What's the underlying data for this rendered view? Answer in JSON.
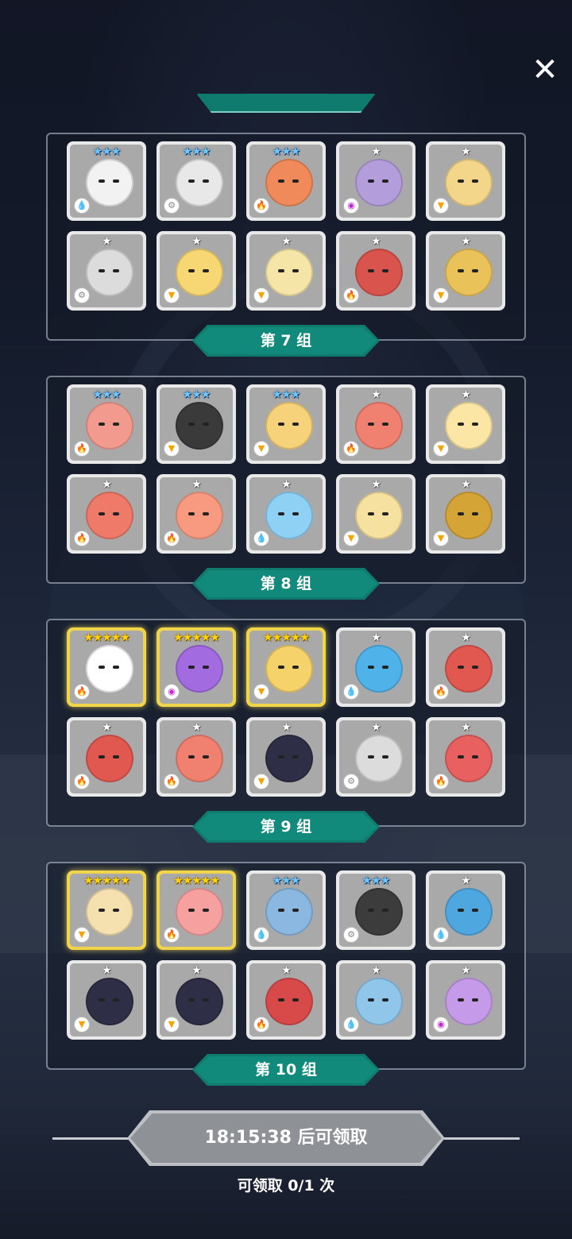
{
  "close_label": "✕",
  "colors": {
    "ribbon": "#0f7a6e",
    "timer_button": "#8e9196",
    "star_blue": "#6ec6ff",
    "star_gold": "#ffd400"
  },
  "groups": [
    {
      "label": "第 7 组",
      "heroes": [
        {
          "stars": "★★★",
          "rank": "blue",
          "element": "water",
          "elem_glyph": "💧",
          "color": "#f2f2f2"
        },
        {
          "stars": "★★★",
          "rank": "blue",
          "element": "neutral",
          "elem_glyph": "⚙",
          "color": "#e8e8e8"
        },
        {
          "stars": "★★★",
          "rank": "blue",
          "element": "fire",
          "elem_glyph": "🔥",
          "color": "#f08a5a"
        },
        {
          "stars": "★",
          "rank": "white",
          "element": "dark",
          "elem_glyph": "◉",
          "color": "#b39ddb"
        },
        {
          "stars": "★",
          "rank": "white",
          "element": "light",
          "elem_glyph": "▼",
          "color": "#f3d68a"
        },
        {
          "stars": "★",
          "rank": "white",
          "element": "neutral",
          "elem_glyph": "⚙",
          "color": "#dcdcdc"
        },
        {
          "stars": "★",
          "rank": "white",
          "element": "light",
          "elem_glyph": "▼",
          "color": "#f7d774"
        },
        {
          "stars": "★",
          "rank": "white",
          "element": "light",
          "elem_glyph": "▼",
          "color": "#f5e6a8"
        },
        {
          "stars": "★",
          "rank": "white",
          "element": "fire",
          "elem_glyph": "🔥",
          "color": "#d9544d"
        },
        {
          "stars": "★",
          "rank": "white",
          "element": "light",
          "elem_glyph": "▼",
          "color": "#e9c25a"
        }
      ]
    },
    {
      "label": "第 8 组",
      "heroes": [
        {
          "stars": "★★★",
          "rank": "blue",
          "element": "fire",
          "elem_glyph": "🔥",
          "color": "#f29a8e"
        },
        {
          "stars": "★★★",
          "rank": "blue",
          "element": "light",
          "elem_glyph": "▼",
          "color": "#3a3a3a"
        },
        {
          "stars": "★★★",
          "rank": "blue",
          "element": "light",
          "elem_glyph": "▼",
          "color": "#f6d27a"
        },
        {
          "stars": "★",
          "rank": "white",
          "element": "fire",
          "elem_glyph": "🔥",
          "color": "#f08070"
        },
        {
          "stars": "★",
          "rank": "white",
          "element": "light",
          "elem_glyph": "▼",
          "color": "#fbe6a6"
        },
        {
          "stars": "★",
          "rank": "white",
          "element": "fire",
          "elem_glyph": "🔥",
          "color": "#ef7a6a"
        },
        {
          "stars": "★",
          "rank": "white",
          "element": "fire",
          "elem_glyph": "🔥",
          "color": "#f79a80"
        },
        {
          "stars": "★",
          "rank": "white",
          "element": "water",
          "elem_glyph": "💧",
          "color": "#8fd0f5"
        },
        {
          "stars": "★",
          "rank": "white",
          "element": "light",
          "elem_glyph": "▼",
          "color": "#f7e1a0"
        },
        {
          "stars": "★",
          "rank": "white",
          "element": "light",
          "elem_glyph": "▼",
          "color": "#d4a437"
        }
      ]
    },
    {
      "label": "第 9 组",
      "heroes": [
        {
          "stars": "★★★★★",
          "rank": "gold",
          "element": "fire",
          "elem_glyph": "🔥",
          "color": "#ffffff"
        },
        {
          "stars": "★★★★★",
          "rank": "gold",
          "element": "dark",
          "elem_glyph": "◉",
          "color": "#a36be0"
        },
        {
          "stars": "★★★★★",
          "rank": "gold",
          "element": "light",
          "elem_glyph": "▼",
          "color": "#f5d36a"
        },
        {
          "stars": "★",
          "rank": "white",
          "element": "water",
          "elem_glyph": "💧",
          "color": "#4fb3ea"
        },
        {
          "stars": "★",
          "rank": "white",
          "element": "fire",
          "elem_glyph": "🔥",
          "color": "#e0584f"
        },
        {
          "stars": "★",
          "rank": "white",
          "element": "fire",
          "elem_glyph": "🔥",
          "color": "#e0584f"
        },
        {
          "stars": "★",
          "rank": "white",
          "element": "fire",
          "elem_glyph": "🔥",
          "color": "#f08070"
        },
        {
          "stars": "★",
          "rank": "white",
          "element": "light",
          "elem_glyph": "▼",
          "color": "#2e2e46"
        },
        {
          "stars": "★",
          "rank": "white",
          "element": "neutral",
          "elem_glyph": "⚙",
          "color": "#dcdcdc"
        },
        {
          "stars": "★",
          "rank": "white",
          "element": "fire",
          "elem_glyph": "🔥",
          "color": "#e86060"
        }
      ]
    },
    {
      "label": "第 10 组",
      "heroes": [
        {
          "stars": "★★★★★",
          "rank": "gold",
          "element": "light",
          "elem_glyph": "▼",
          "color": "#f5e0b0"
        },
        {
          "stars": "★★★★★",
          "rank": "gold",
          "element": "fire",
          "elem_glyph": "🔥",
          "color": "#f7a0a0"
        },
        {
          "stars": "★★★",
          "rank": "blue",
          "element": "water",
          "elem_glyph": "💧",
          "color": "#8ab8e0"
        },
        {
          "stars": "★★★",
          "rank": "blue",
          "element": "neutral",
          "elem_glyph": "⚙",
          "color": "#3c3c3c"
        },
        {
          "stars": "★",
          "rank": "white",
          "element": "water",
          "elem_glyph": "💧",
          "color": "#4fa7e0"
        },
        {
          "stars": "★",
          "rank": "white",
          "element": "light",
          "elem_glyph": "▼",
          "color": "#2e2e46"
        },
        {
          "stars": "★",
          "rank": "white",
          "element": "light",
          "elem_glyph": "▼",
          "color": "#2e2e46"
        },
        {
          "stars": "★",
          "rank": "white",
          "element": "fire",
          "elem_glyph": "🔥",
          "color": "#d84a4a"
        },
        {
          "stars": "★",
          "rank": "white",
          "element": "water",
          "elem_glyph": "💧",
          "color": "#8fc6ea"
        },
        {
          "stars": "★",
          "rank": "white",
          "element": "dark",
          "elem_glyph": "◉",
          "color": "#c59ae8"
        }
      ]
    }
  ],
  "timer_label": "18:15:38 后可领取",
  "claim_count": "可领取 0/1 次"
}
